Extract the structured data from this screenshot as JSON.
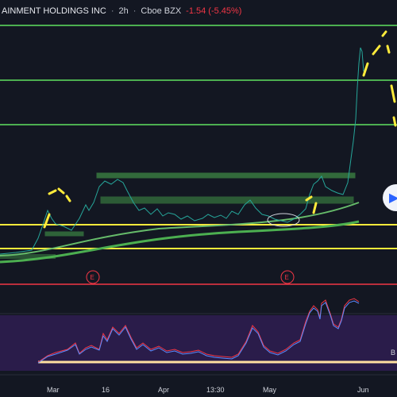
{
  "header": {
    "title": "AINMENT HOLDINGS INC",
    "separator": "·",
    "interval": "2h",
    "exchange": "Cboe BZX",
    "change": "-1.54 (-5.45%)"
  },
  "earnings_badges": [
    "E",
    "E"
  ],
  "time_axis": [
    "Mar",
    "16",
    "Apr",
    "13:30",
    "May",
    "Jun"
  ],
  "indicator_label": "B",
  "colors": {
    "background": "#131722",
    "green_line": "#4caf50",
    "yellow_line": "#ffeb3b",
    "red_line": "#f23645",
    "indicator_bg": "#2a1c4a",
    "price_line": "#26a69a"
  },
  "icons": {
    "scroll_button": "arrow-right-icon"
  }
}
